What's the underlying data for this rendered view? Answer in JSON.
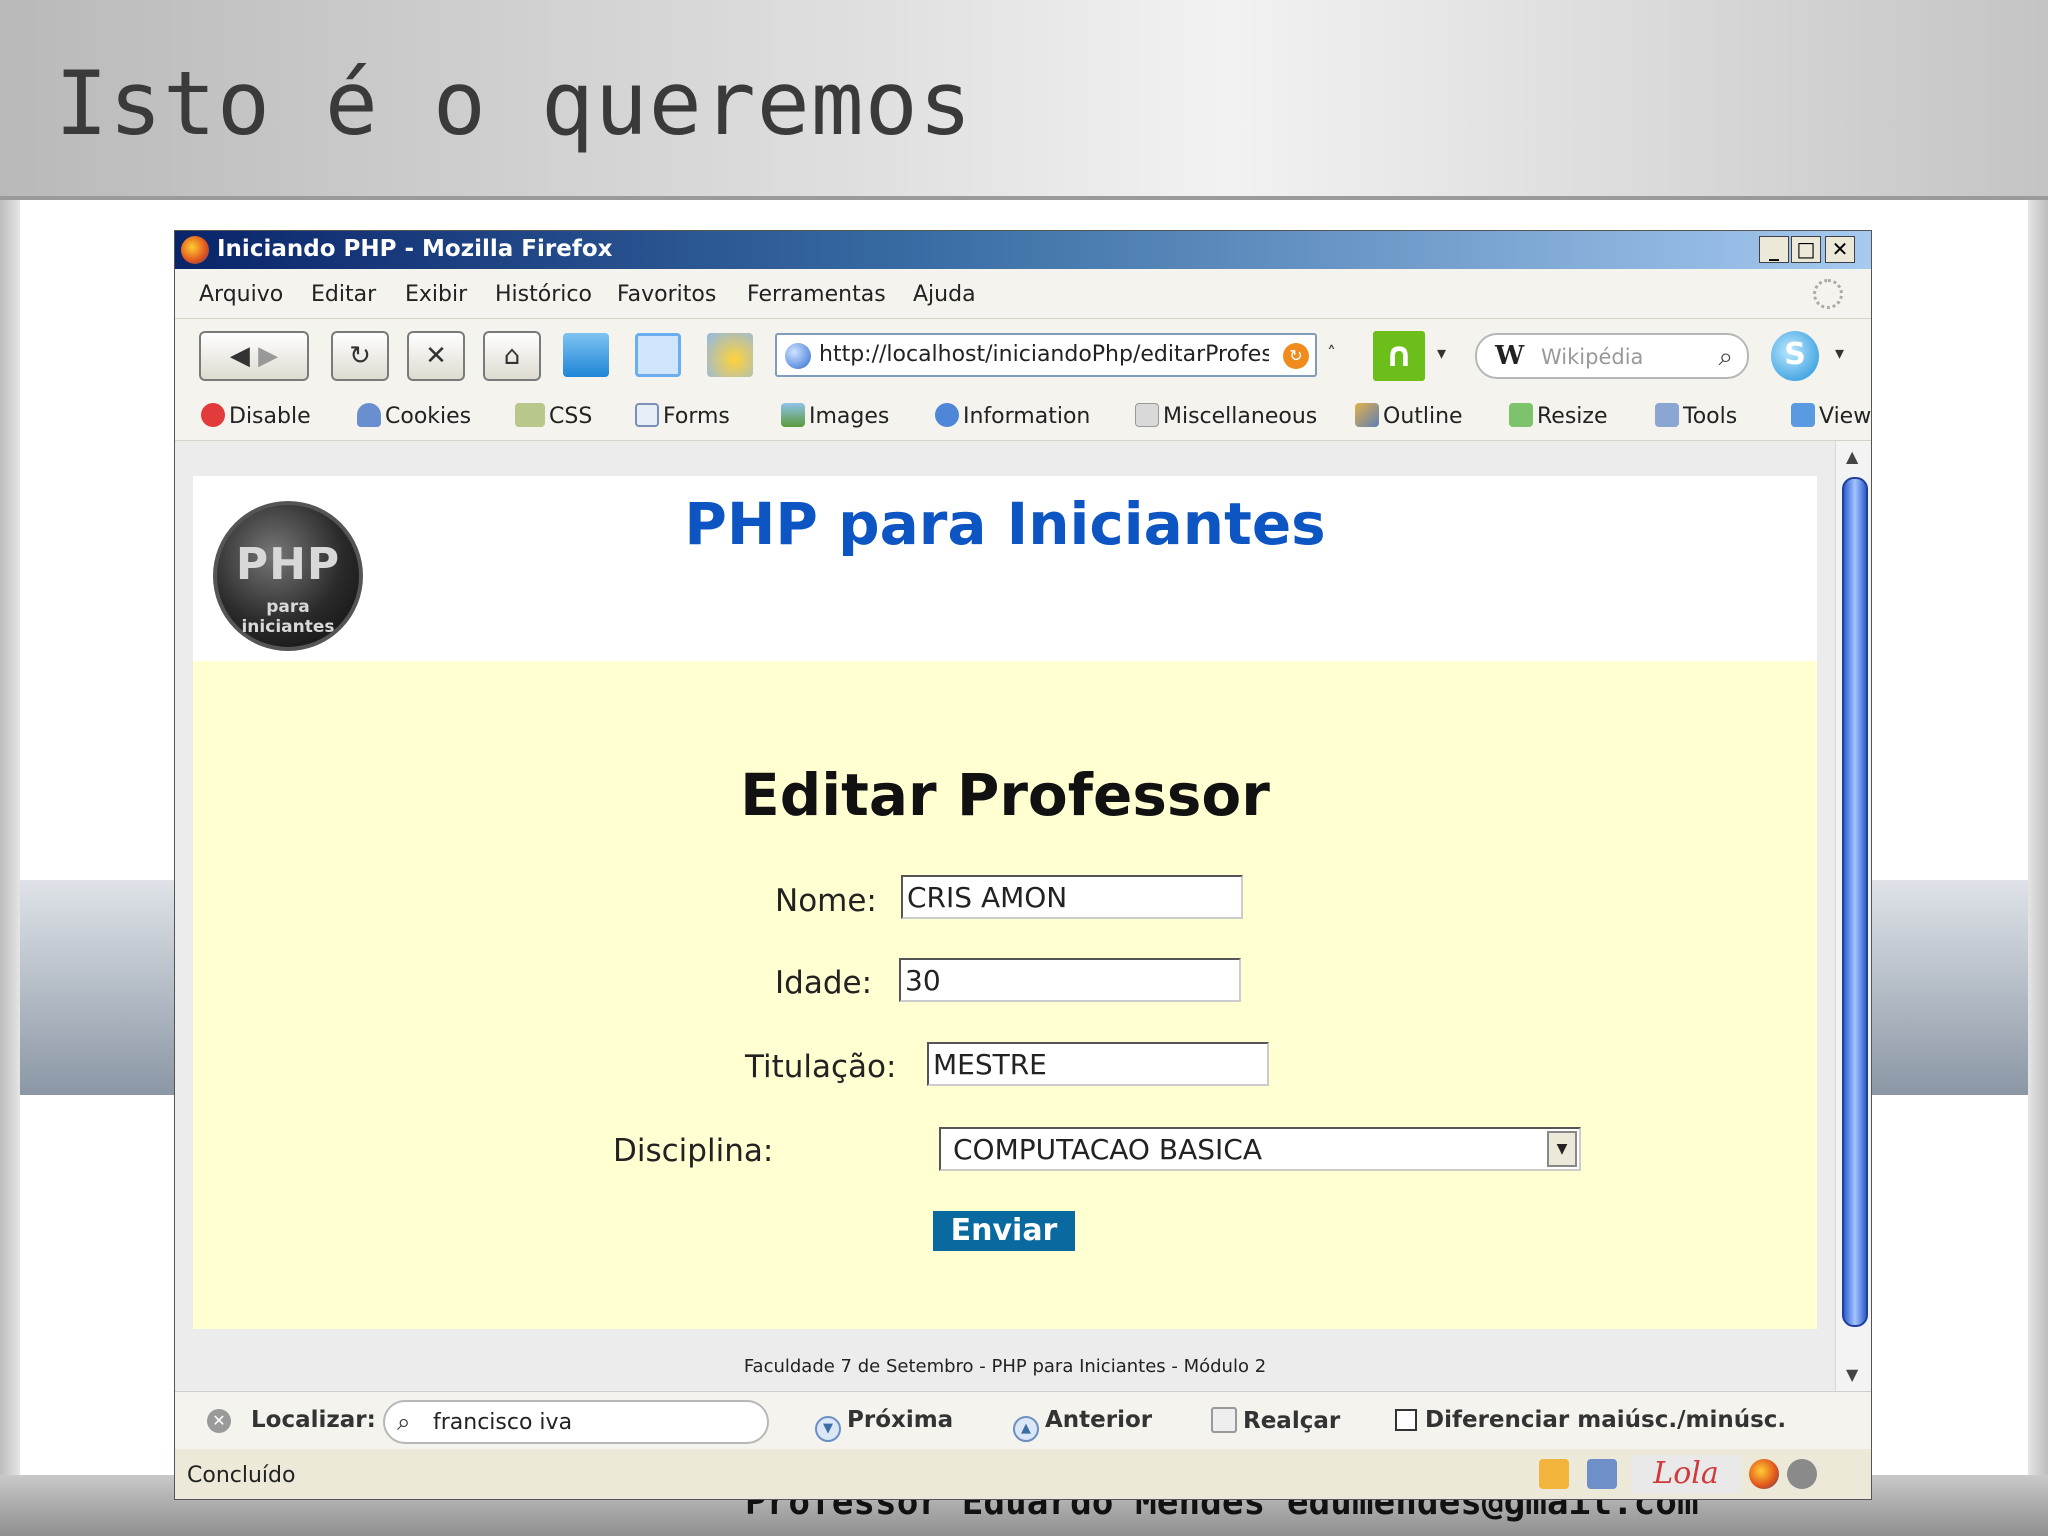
{
  "slide": {
    "title": "Isto é o queremos",
    "footer": "Professor Eduardo Mendes edumendes@gmail.com"
  },
  "browser": {
    "window_title": "Iniciando PHP - Mozilla Firefox",
    "window_buttons": {
      "minimize": "_",
      "maximize": "□",
      "close": "✕"
    },
    "menu": [
      "Arquivo",
      "Editar",
      "Exibir",
      "Histórico",
      "Favoritos",
      "Ferramentas",
      "Ajuda"
    ],
    "nav": {
      "back": "◀",
      "forward": "▶",
      "reload": "↻",
      "stop": "✕",
      "home": "⌂",
      "url": "http://localhost/iniciandoPhp/editarProfesso",
      "search_placeholder": "Wikipédia",
      "search_engine_logo": "W"
    },
    "dev_toolbar": [
      "Disable",
      "Cookies",
      "CSS",
      "Forms",
      "Images",
      "Information",
      "Miscellaneous",
      "Outline",
      "Resize",
      "Tools",
      "View"
    ],
    "find_bar": {
      "label": "Localizar:",
      "value": "francisco iva",
      "next": "Próxima",
      "previous": "Anterior",
      "highlight": "Realçar",
      "match_case": "Diferenciar maiúsc./minúsc."
    },
    "status": "Concluído",
    "status_logo": "Lola"
  },
  "page": {
    "site_title": "PHP para Iniciantes",
    "logo_big": "PHP",
    "logo_small": "para iniciantes",
    "form_title": "Editar Professor",
    "fields": {
      "nome_label": "Nome:",
      "nome_value": "CRIS AMON",
      "idade_label": "Idade:",
      "idade_value": "30",
      "titulacao_label": "Titulação:",
      "titulacao_value": "MESTRE",
      "disciplina_label": "Disciplina:",
      "disciplina_value": "COMPUTACAO BASICA"
    },
    "submit": "Enviar",
    "footer": "Faculdade 7 de Setembro - PHP para Iniciantes - Módulo 2"
  },
  "colors": {
    "site_title": "#0d55c2",
    "form_background": "#ffffd2",
    "submit_button": "#0a6aa0"
  },
  "icons": {
    "window": "firefox-icon",
    "search": "magnifier-icon",
    "url_page": "globe-icon",
    "url_go": "go-arrow-icon",
    "status": [
      "notes-icon",
      "save-icon",
      "lola-icon",
      "firefox-icon",
      "gear-icon"
    ]
  }
}
